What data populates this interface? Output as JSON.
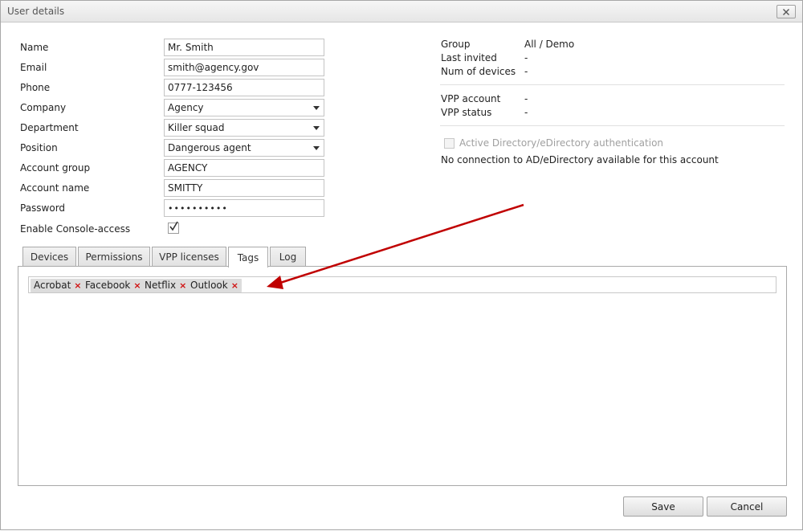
{
  "window": {
    "title": "User details",
    "close_icon": "close-icon"
  },
  "form": {
    "name": {
      "label": "Name",
      "value": "Mr. Smith"
    },
    "email": {
      "label": "Email",
      "value": "smith@agency.gov"
    },
    "phone": {
      "label": "Phone",
      "value": "0777-123456"
    },
    "company": {
      "label": "Company",
      "value": "Agency"
    },
    "department": {
      "label": "Department",
      "value": "Killer squad"
    },
    "position": {
      "label": "Position",
      "value": "Dangerous agent"
    },
    "account_group": {
      "label": "Account group",
      "value": "AGENCY"
    },
    "account_name": {
      "label": "Account name",
      "value": "SMITTY"
    },
    "password": {
      "label": "Password",
      "value": "••••••••••"
    },
    "console_access": {
      "label": "Enable Console-access",
      "checked": true
    }
  },
  "info": {
    "group": {
      "label": "Group",
      "value": "All / Demo"
    },
    "last_invited": {
      "label": "Last invited",
      "value": "-"
    },
    "num_devices": {
      "label": "Num of devices",
      "value": "-"
    },
    "vpp_account": {
      "label": "VPP account",
      "value": "-"
    },
    "vpp_status": {
      "label": "VPP status",
      "value": "-"
    },
    "ad_auth": {
      "label": "Active Directory/eDirectory authentication",
      "checked": false,
      "disabled": true
    },
    "ad_note": "No connection to AD/eDirectory available for this account"
  },
  "tabs": [
    {
      "label": "Devices"
    },
    {
      "label": "Permissions"
    },
    {
      "label": "VPP licenses"
    },
    {
      "label": "Tags"
    },
    {
      "label": "Log"
    }
  ],
  "active_tab": "Tags",
  "tags": [
    {
      "label": "Acrobat",
      "remove": "×"
    },
    {
      "label": "Facebook",
      "remove": "×"
    },
    {
      "label": "Netflix",
      "remove": "×"
    },
    {
      "label": "Outlook",
      "remove": "×"
    }
  ],
  "buttons": {
    "save": "Save",
    "cancel": "Cancel"
  },
  "colors": {
    "annotation_arrow": "#c00000",
    "tag_remove": "#d01010",
    "tag_bg": "#dcdcdc"
  }
}
